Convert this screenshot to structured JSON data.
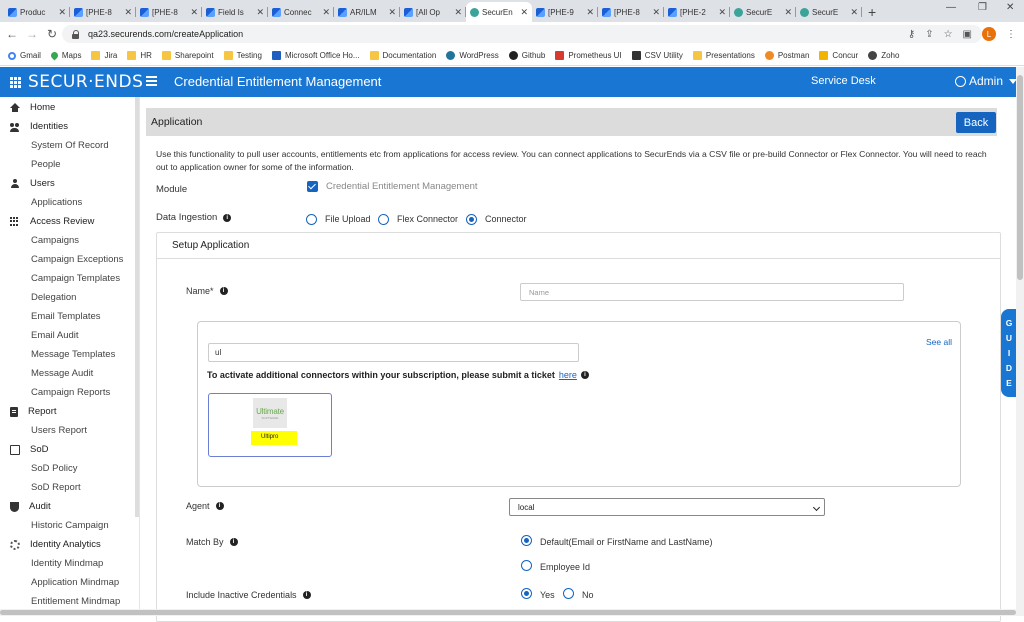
{
  "browser": {
    "tabs": [
      {
        "label": "Produc",
        "icon": "jira-icon",
        "active": false
      },
      {
        "label": "[PHE-8",
        "icon": "jira-icon",
        "active": false
      },
      {
        "label": "[PHE-8",
        "icon": "jira-icon",
        "active": false
      },
      {
        "label": "Field Is",
        "icon": "jira-icon",
        "active": false
      },
      {
        "label": "Connec",
        "icon": "jira-icon",
        "active": false
      },
      {
        "label": "AR/ILM",
        "icon": "jira-icon",
        "active": false
      },
      {
        "label": "[All Op",
        "icon": "jira-icon",
        "active": false
      },
      {
        "label": "SecurEn",
        "icon": "securends-icon",
        "active": true
      },
      {
        "label": "[PHE-9",
        "icon": "jira-icon",
        "active": false
      },
      {
        "label": "[PHE-8",
        "icon": "jira-icon",
        "active": false
      },
      {
        "label": "[PHE-2",
        "icon": "jira-icon",
        "active": false
      },
      {
        "label": "SecurE",
        "icon": "securends-icon",
        "active": false
      },
      {
        "label": "SecurE",
        "icon": "securends-icon",
        "active": false
      }
    ],
    "url": "qa23.securends.com/createApplication",
    "profile_initial": "L",
    "bookmarks": [
      {
        "label": "Gmail",
        "icon": "g"
      },
      {
        "label": "Maps",
        "icon": "map"
      },
      {
        "label": "Jira",
        "icon": "folder"
      },
      {
        "label": "HR",
        "icon": "folder"
      },
      {
        "label": "Sharepoint",
        "icon": "folder"
      },
      {
        "label": "Testing",
        "icon": "folder"
      },
      {
        "label": "Microsoft Office Ho...",
        "icon": "blue"
      },
      {
        "label": "Documentation",
        "icon": "folder"
      },
      {
        "label": "WordPress",
        "icon": "wp"
      },
      {
        "label": "Github",
        "icon": "gh"
      },
      {
        "label": "Prometheus UI",
        "icon": "red"
      },
      {
        "label": "CSV Utility",
        "icon": "dark"
      },
      {
        "label": "Presentations",
        "icon": "folder"
      },
      {
        "label": "Postman",
        "icon": "org"
      },
      {
        "label": "Concur",
        "icon": "yel"
      },
      {
        "label": "Zoho",
        "icon": "zoho"
      }
    ]
  },
  "header": {
    "logo": "SECUR·ENDS",
    "title": "Credential Entitlement Management",
    "service_desk": "Service Desk",
    "admin": "Admin",
    "brand_color": "#1976d2"
  },
  "sidebar": {
    "items": [
      {
        "label": "Home",
        "type": "sec",
        "icon": "home"
      },
      {
        "label": "Identities",
        "type": "sec",
        "icon": "people"
      },
      {
        "label": "System Of Record",
        "type": "sub"
      },
      {
        "label": "People",
        "type": "sub"
      },
      {
        "label": "Users",
        "type": "sec",
        "icon": "user"
      },
      {
        "label": "Applications",
        "type": "sub"
      },
      {
        "label": "Access Review",
        "type": "sec",
        "icon": "grid"
      },
      {
        "label": "Campaigns",
        "type": "sub"
      },
      {
        "label": "Campaign Exceptions",
        "type": "sub"
      },
      {
        "label": "Campaign Templates",
        "type": "sub"
      },
      {
        "label": "Delegation",
        "type": "sub"
      },
      {
        "label": "Email Templates",
        "type": "sub"
      },
      {
        "label": "Email Audit",
        "type": "sub"
      },
      {
        "label": "Message Templates",
        "type": "sub"
      },
      {
        "label": "Message Audit",
        "type": "sub"
      },
      {
        "label": "Campaign Reports",
        "type": "sub"
      },
      {
        "label": "Report",
        "type": "sec",
        "icon": "doc"
      },
      {
        "label": "Users Report",
        "type": "sub"
      },
      {
        "label": "SoD",
        "type": "sec",
        "icon": "box"
      },
      {
        "label": "SoD Policy",
        "type": "sub"
      },
      {
        "label": "SoD Report",
        "type": "sub"
      },
      {
        "label": "Audit",
        "type": "sec",
        "icon": "shield"
      },
      {
        "label": "Historic Campaign",
        "type": "sub"
      },
      {
        "label": "Identity Analytics",
        "type": "sec",
        "icon": "gear"
      },
      {
        "label": "Identity Mindmap",
        "type": "sub"
      },
      {
        "label": "Application Mindmap",
        "type": "sub"
      },
      {
        "label": "Entitlement Mindmap",
        "type": "sub"
      }
    ]
  },
  "page": {
    "title": "Application",
    "back_label": "Back",
    "description": "Use this functionality to pull user accounts, entitlements etc from applications for access review. You can connect applications to SecurEnds via a CSV file or pre-build Connector or Flex Connector. You will need to reach out to application owner for some of the information.",
    "module_label": "Module",
    "module_option": "Credential Entitlement Management",
    "ingestion_label": "Data Ingestion",
    "ingestion_options": [
      "File Upload",
      "Flex Connector",
      "Connector"
    ],
    "ingestion_selected": "Connector",
    "setup_title": "Setup Application",
    "name_label": "Name*",
    "name_placeholder": "Name",
    "see_all": "See all",
    "connector_search": "ul",
    "activate_text": "To activate additional connectors within your subscription, please submit a ticket",
    "activate_link": "here",
    "connector_logo": "Ultimate",
    "connector_logo_sub": "SOFTWARE",
    "connector_name": "Ultipro",
    "agent_label": "Agent",
    "agent_value": "local",
    "match_label": "Match By",
    "match_options": [
      "Default(Email or FirstName and LastName)",
      "Employee Id"
    ],
    "inactive_label": "Include Inactive Credentials",
    "inactive_options": [
      "Yes",
      "No"
    ]
  },
  "guide": "GUIDE"
}
